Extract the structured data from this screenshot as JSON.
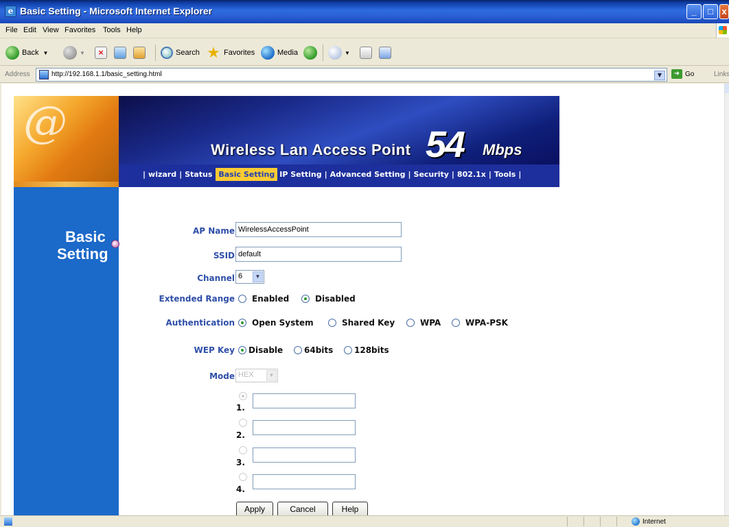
{
  "window": {
    "title": "Basic Setting - Microsoft Internet Explorer"
  },
  "menu": [
    "File",
    "Edit",
    "View",
    "Favorites",
    "Tools",
    "Help"
  ],
  "toolbar": {
    "back": "Back",
    "search": "Search",
    "favorites": "Favorites",
    "media": "Media"
  },
  "address": {
    "label": "Address",
    "url": "http://192.168.1.1/basic_setting.html",
    "go": "Go",
    "links": "Links"
  },
  "banner": {
    "title": "Wireless Lan Access Point",
    "speed": "54",
    "unit": "Mbps"
  },
  "nav": [
    "wizard",
    "Status",
    "Basic Setting",
    "IP Setting",
    "Advanced Setting",
    "Security",
    "802.1x",
    "Tools"
  ],
  "sidebar": {
    "line1": "Basic",
    "line2": "Setting"
  },
  "form": {
    "ap_name_label": "AP Name",
    "ap_name_value": "WirelessAccessPoint",
    "ssid_label": "SSID",
    "ssid_value": "default",
    "channel_label": "Channel",
    "channel_value": "6",
    "ext_range_label": "Extended Range",
    "ext_range_options": [
      "Enabled",
      "Disabled"
    ],
    "ext_range_selected": "Disabled",
    "auth_label": "Authentication",
    "auth_options": [
      "Open System",
      "Shared Key",
      "WPA",
      "WPA-PSK"
    ],
    "auth_selected": "Open System",
    "wep_label": "WEP Key",
    "wep_options": [
      "Disable",
      "64bits",
      "128bits"
    ],
    "wep_selected": "Disable",
    "mode_label": "Mode",
    "mode_value": "HEX",
    "keys": [
      "1.",
      "2.",
      "3.",
      "4."
    ]
  },
  "buttons": {
    "apply": "Apply",
    "cancel": "Cancel",
    "help": "Help"
  },
  "status": {
    "zone": "Internet"
  }
}
